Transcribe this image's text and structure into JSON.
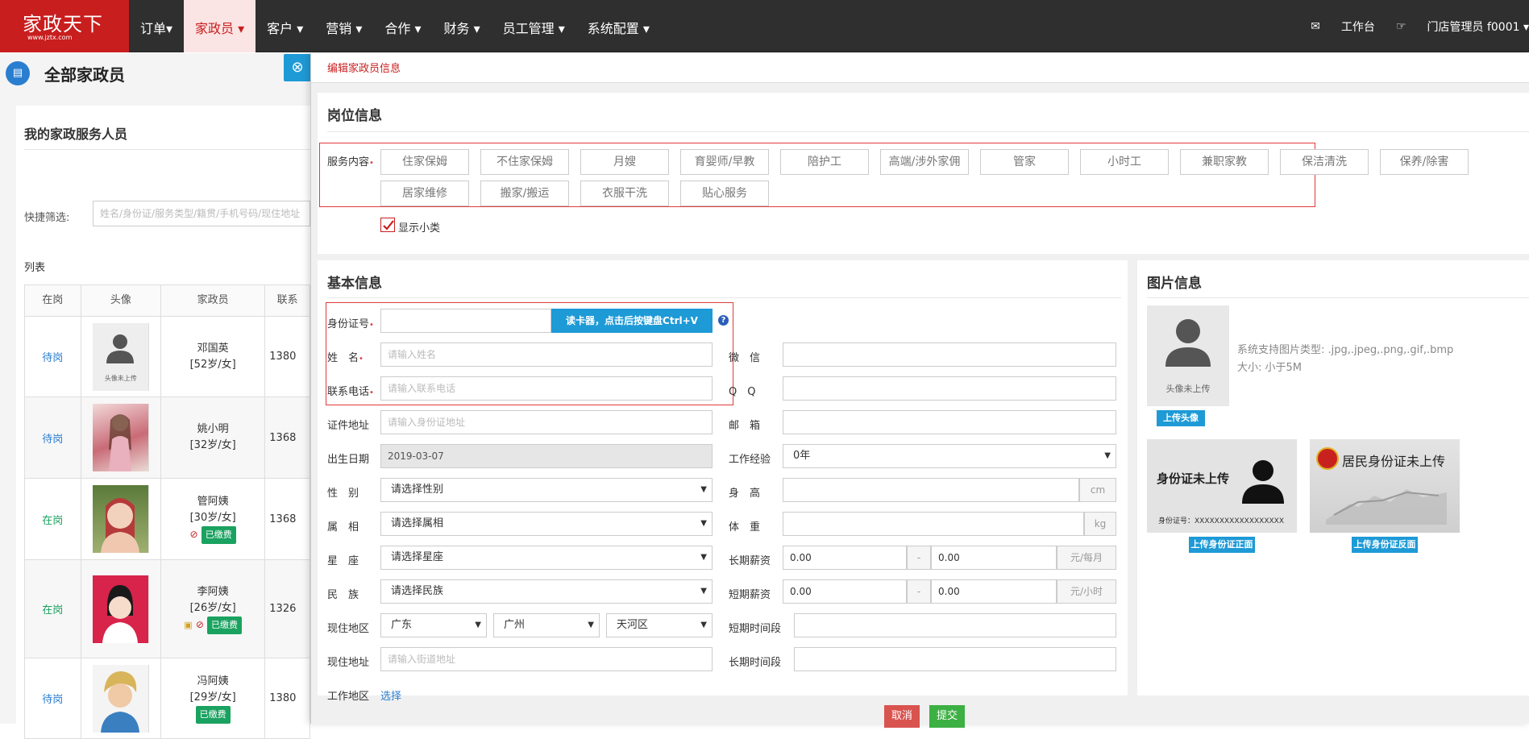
{
  "brand": {
    "logo_text": "家政天下",
    "logo_url_text": "www.jztx.com"
  },
  "nav": [
    {
      "label": "订单▾"
    },
    {
      "label": "家政员 ▾"
    },
    {
      "label": "客户 ▾"
    },
    {
      "label": "营销 ▾"
    },
    {
      "label": "合作 ▾"
    },
    {
      "label": "财务 ▾"
    },
    {
      "label": "员工管理 ▾"
    },
    {
      "label": "系统配置 ▾"
    }
  ],
  "right_nav": {
    "workbench": "工作台",
    "user": "门店管理员 f0001 ▾"
  },
  "left": {
    "title": "全部家政员",
    "subtitle": "我的家政服务人员",
    "filter_label": "快捷筛选:",
    "filter_placeholder": "姓名/身份证/服务类型/籍贯/手机号码/现住地址",
    "list_label": "列表",
    "columns": [
      "在岗",
      "头像",
      "家政员",
      "联系"
    ],
    "rows": [
      {
        "status": "待岗",
        "name": "邓国英",
        "info": "[52岁/女]",
        "phone": "1380",
        "badge": "",
        "avatar_text": "头像未上传"
      },
      {
        "status": "待岗",
        "name": "姚小明",
        "info": "[32岁/女]",
        "phone": "1368",
        "badge": "",
        "avatar_text": ""
      },
      {
        "status": "在岗",
        "name": "管阿姨",
        "info": "[30岁/女]",
        "phone": "1368",
        "badge": "已缴费",
        "avatar_text": ""
      },
      {
        "status": "在岗",
        "name": "李阿姨",
        "info": "[26岁/女]",
        "phone": "1326",
        "badge": "已缴费",
        "avatar_text": ""
      },
      {
        "status": "待岗",
        "name": "冯阿姨",
        "info": "[29岁/女]",
        "phone": "1380",
        "badge": "已缴费",
        "avatar_text": ""
      }
    ]
  },
  "modal": {
    "title": "编辑家政员信息",
    "job_section": "岗位信息",
    "service_label": "服务内容",
    "services": [
      "住家保姆",
      "不住家保姆",
      "月嫂",
      "育婴师/早教",
      "陪护工",
      "高端/涉外家佣",
      "管家",
      "小时工",
      "兼职家教",
      "保洁清洗",
      "保养/除害",
      "居家维修",
      "搬家/搬运",
      "衣服干洗",
      "贴心服务"
    ],
    "show_sub_label": "显示小类",
    "basic_section": "基本信息",
    "image_section": "图片信息",
    "fields": {
      "id_label": "身份证号",
      "read_card": "读卡器，点击后按键盘Ctrl+V",
      "name_label": "姓　名",
      "name_ph": "请输入姓名",
      "phone_label": "联系电话",
      "phone_ph": "请输入联系电话",
      "addr_label": "证件地址",
      "addr_ph": "请输入身份证地址",
      "birth_label": "出生日期",
      "birth_val": "2019-03-07",
      "gender_label": "性　别",
      "gender_val": "请选择性别",
      "zodiac_label": "属　相",
      "zodiac_val": "请选择属相",
      "star_label": "星　座",
      "star_val": "请选择星座",
      "nation_label": "民　族",
      "nation_val": "请选择民族",
      "area_label": "现住地区",
      "province": "广东",
      "city": "广州",
      "district": "天河区",
      "street_label": "现住地址",
      "street_ph": "请输入街道地址",
      "work_area_label": "工作地区",
      "work_area_link": "选择",
      "wechat_label": "微　信",
      "qq_label": "Q　Q",
      "email_label": "邮　箱",
      "exp_label": "工作经验",
      "exp_val": "0年",
      "height_label": "身　高",
      "height_unit": "cm",
      "weight_label": "体　重",
      "weight_unit": "kg",
      "long_salary_label": "长期薪资",
      "long_min": "0.00",
      "long_max": "0.00",
      "long_unit": "元/每月",
      "short_salary_label": "短期薪资",
      "short_min": "0.00",
      "short_max": "0.00",
      "short_unit": "元/小时",
      "dash": "-",
      "short_time_label": "短期时间段",
      "long_time_label": "长期时间段"
    },
    "images": {
      "avatar_text": "头像未上传",
      "support_text": "系统支持图片类型: .jpg,.jpeg,.png,.gif,.bmp",
      "size_text": "大小: 小于5M",
      "upload_avatar": "上传头像",
      "id_front_title": "身份证未上传",
      "id_front_no": "身份证号：XXXXXXXXXXXXXXXXXX",
      "id_back_title": "居民身份证未上传",
      "upload_front": "上传身份证正面",
      "upload_back": "上传身份证反面"
    },
    "cancel": "取消",
    "submit": "提交"
  }
}
